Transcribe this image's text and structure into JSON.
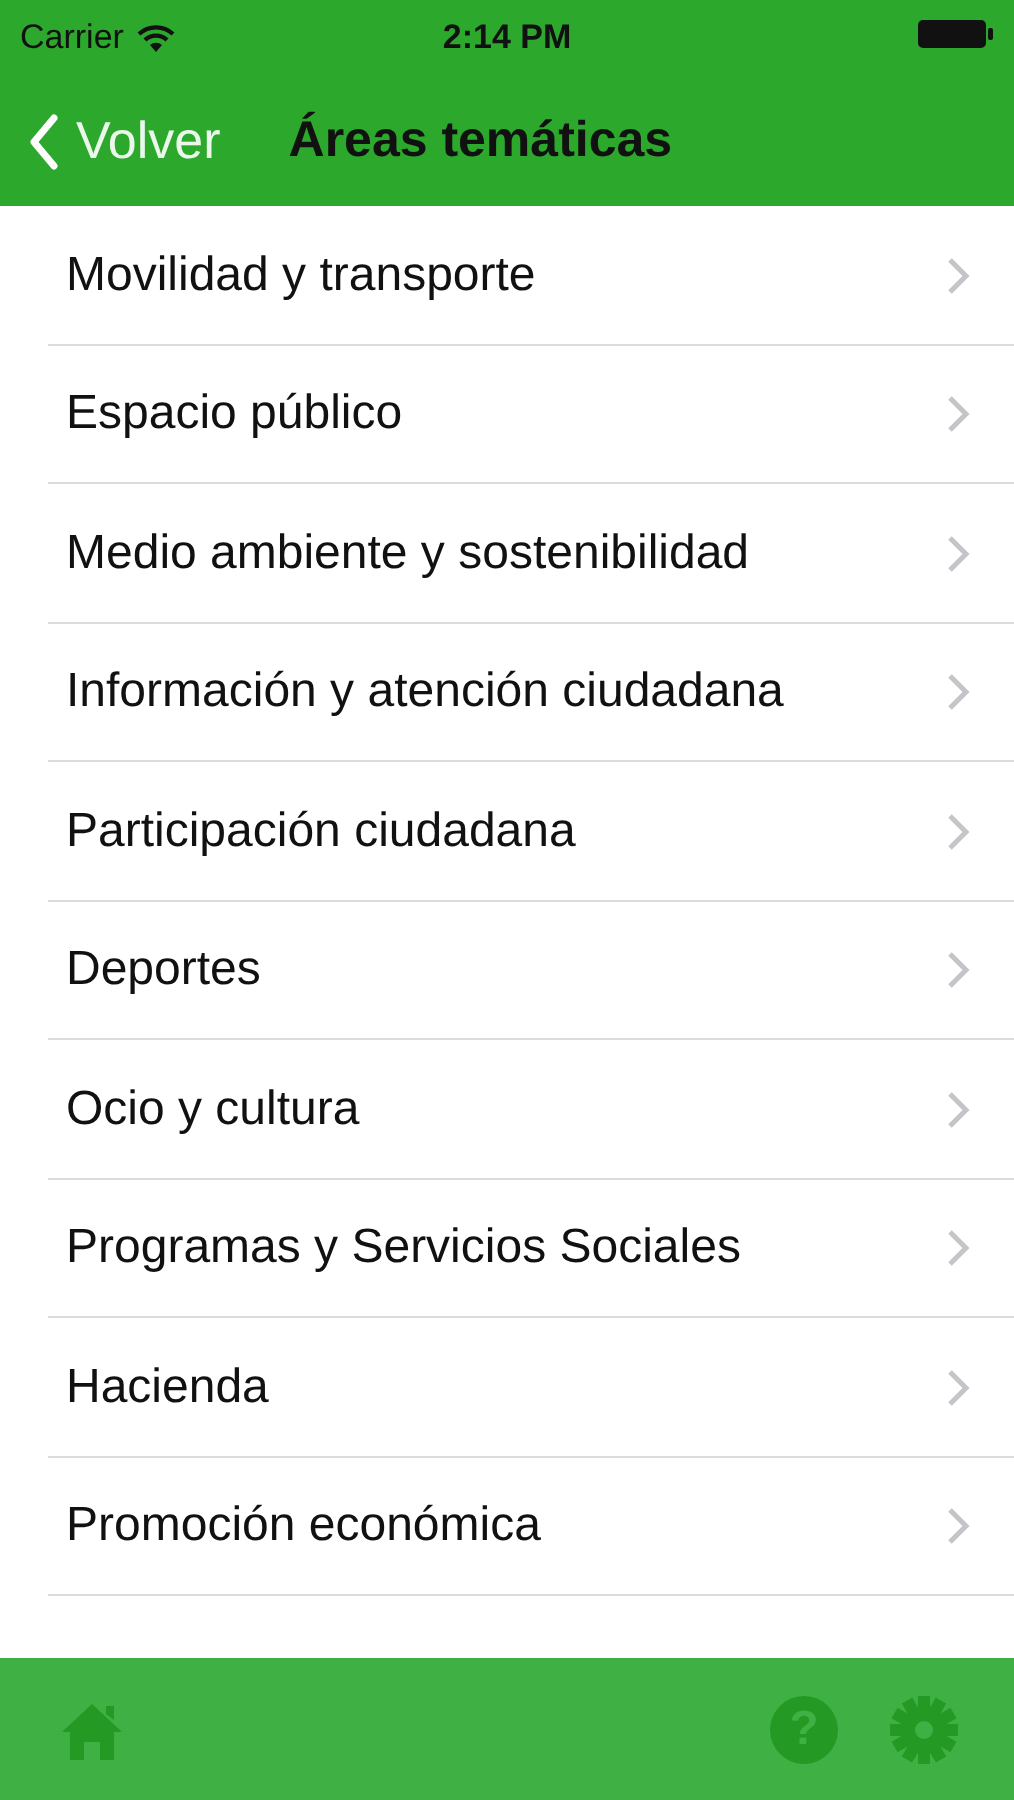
{
  "status_bar": {
    "carrier": "Carrier",
    "time": "2:14 PM"
  },
  "nav_bar": {
    "back": "Volver",
    "title": "Áreas temáticas"
  },
  "items": [
    {
      "label": "Movilidad y transporte"
    },
    {
      "label": "Espacio público"
    },
    {
      "label": "Medio ambiente y sostenibilidad"
    },
    {
      "label": "Información y atención ciudadana"
    },
    {
      "label": "Participación ciudadana"
    },
    {
      "label": "Deportes"
    },
    {
      "label": "Ocio y cultura"
    },
    {
      "label": "Programas y Servicios Sociales"
    },
    {
      "label": "Hacienda"
    },
    {
      "label": "Promoción económica"
    }
  ],
  "tab_bar": {
    "help": "?"
  }
}
